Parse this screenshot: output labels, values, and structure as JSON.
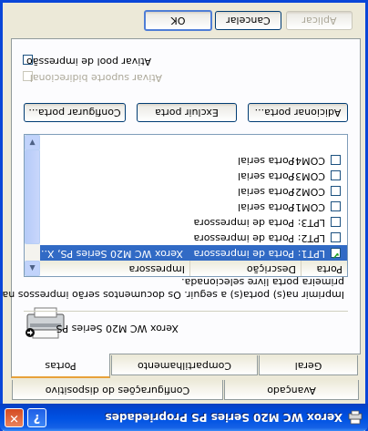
{
  "window": {
    "title": "Xerox WC M20 Series PS Propriedades",
    "help_label": "?",
    "close_label": "✕"
  },
  "tabs": [
    {
      "label": "Geral"
    },
    {
      "label": "Compartilhamento"
    },
    {
      "label": "Portas"
    },
    {
      "label": "Avançado"
    },
    {
      "label": "Configurações do dispositivo"
    }
  ],
  "printer": {
    "name": "Xerox WC M20 Series PS"
  },
  "description": {
    "line1": "Imprimir na(s) porta(s) a seguir. Os documentos serão impressos na",
    "line2": "primeira porta livre selecionada."
  },
  "ports_list": {
    "columns": [
      "Porta",
      "Descrição",
      "Impressora"
    ],
    "rows": [
      {
        "port": "LPT1:",
        "desc": "Porta de impressora",
        "printer": "Xerox WC M20 Series PS, X...",
        "checked": true,
        "selected": true
      },
      {
        "port": "LPT2:",
        "desc": "Porta de impressora",
        "printer": "",
        "checked": false,
        "selected": false
      },
      {
        "port": "LPT3:",
        "desc": "Porta de impressora",
        "printer": "",
        "checked": false,
        "selected": false
      },
      {
        "port": "COM1:",
        "desc": "Porta serial",
        "printer": "",
        "checked": false,
        "selected": false
      },
      {
        "port": "COM2:",
        "desc": "Porta serial",
        "printer": "",
        "checked": false,
        "selected": false
      },
      {
        "port": "COM3:",
        "desc": "Porta serial",
        "printer": "",
        "checked": false,
        "selected": false
      },
      {
        "port": "COM4:",
        "desc": "Porta serial",
        "printer": "",
        "checked": false,
        "selected": false
      }
    ]
  },
  "port_buttons": {
    "add": "Adicionar porta...",
    "delete": "Excluir porta",
    "configure": "Configurar porta..."
  },
  "options": {
    "bidirectional": {
      "label": "Ativar suporte bidirecional",
      "checked": false,
      "enabled": false
    },
    "pool": {
      "label": "Ativar pool de impressão",
      "checked": false,
      "enabled": true
    }
  },
  "dialog_buttons": {
    "ok": "OK",
    "cancel": "Cancelar",
    "apply": "Aplicar"
  }
}
